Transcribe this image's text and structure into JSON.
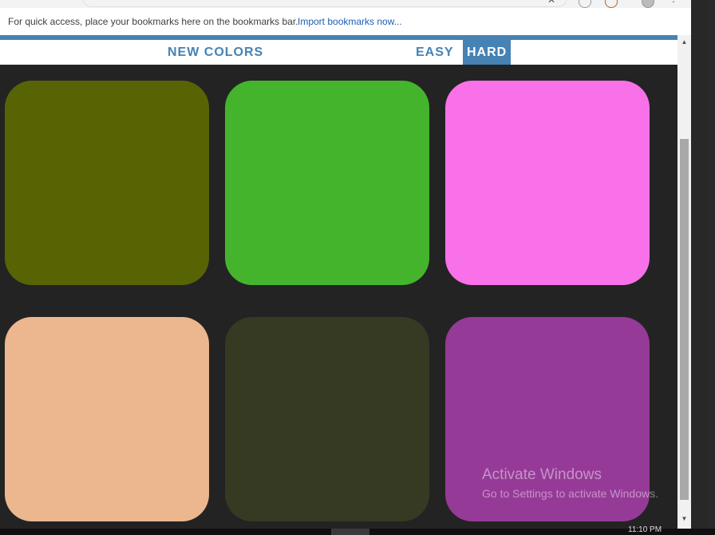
{
  "bookmarks_bar": {
    "message": "For quick access, place your bookmarks here on the bookmarks bar.",
    "import_link": "Import bookmarks now..."
  },
  "nav": {
    "new_colors": "NEW COLORS",
    "easy": "EASY",
    "hard": "HARD",
    "selected_mode": "hard"
  },
  "colors": {
    "accent": "#4682b4",
    "background": "#232323"
  },
  "squares": [
    {
      "color": "#586404"
    },
    {
      "color": "#45b42d"
    },
    {
      "color": "#f871e8"
    },
    {
      "color": "#ecb78e"
    },
    {
      "color": "#363a23"
    },
    {
      "color": "#963a98"
    }
  ],
  "watermark": {
    "title": "Activate Windows",
    "subtitle": "Go to Settings to activate Windows."
  },
  "taskbar": {
    "clock": "11:10 PM"
  }
}
